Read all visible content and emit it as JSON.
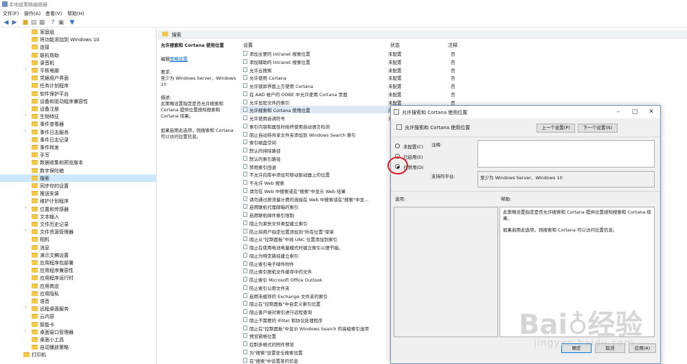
{
  "window": {
    "title": "本地组策略编辑器"
  },
  "menu": [
    "文件(F)",
    "操作(A)",
    "查看(V)",
    "帮助(H)"
  ],
  "tree": [
    {
      "label": "家庭组",
      "arrow": false
    },
    {
      "label": "将功能添加到 Windows 10",
      "arrow": false
    },
    {
      "label": "连接",
      "arrow": false
    },
    {
      "label": "联机帮助",
      "arrow": false
    },
    {
      "label": "录音机",
      "arrow": false
    },
    {
      "label": "平板电脑",
      "arrow": true
    },
    {
      "label": "凭据用户界面",
      "arrow": false
    },
    {
      "label": "任务计划程序",
      "arrow": false
    },
    {
      "label": "软件保护平台",
      "arrow": false
    },
    {
      "label": "设备和驱动程序兼容性",
      "arrow": false
    },
    {
      "label": "设备注册",
      "arrow": false
    },
    {
      "label": "生物特征",
      "arrow": true
    },
    {
      "label": "事件查看器",
      "arrow": false
    },
    {
      "label": "事件日志服务",
      "arrow": true
    },
    {
      "label": "事件日志记录",
      "arrow": false
    },
    {
      "label": "事件转发",
      "arrow": false
    },
    {
      "label": "手写",
      "arrow": false
    },
    {
      "label": "数据收集和预览版本",
      "arrow": false
    },
    {
      "label": "数字保险箱",
      "arrow": false
    },
    {
      "label": "搜索",
      "arrow": false,
      "selected": true
    },
    {
      "label": "同步你的设置",
      "arrow": false
    },
    {
      "label": "推送安装",
      "arrow": false
    },
    {
      "label": "维护计划程序",
      "arrow": false
    },
    {
      "label": "位置和传感器",
      "arrow": true
    },
    {
      "label": "文本输入",
      "arrow": false
    },
    {
      "label": "文件历史记录",
      "arrow": false
    },
    {
      "label": "文件资源管理器",
      "arrow": true
    },
    {
      "label": "相机",
      "arrow": false
    },
    {
      "label": "消息",
      "arrow": false
    },
    {
      "label": "演示文稿设置",
      "arrow": false
    },
    {
      "label": "应用程序包部署",
      "arrow": false
    },
    {
      "label": "应用程序兼容性",
      "arrow": false
    },
    {
      "label": "应用程序运行时",
      "arrow": false
    },
    {
      "label": "应用商店",
      "arrow": false
    },
    {
      "label": "应用隐私",
      "arrow": false
    },
    {
      "label": "语音",
      "arrow": false
    },
    {
      "label": "远程桌面服务",
      "arrow": true
    },
    {
      "label": "云内容",
      "arrow": false
    },
    {
      "label": "智能卡",
      "arrow": false
    },
    {
      "label": "桌面窗口管理器",
      "arrow": true
    },
    {
      "label": "桌面小工具",
      "arrow": false
    },
    {
      "label": "自动播放策略",
      "arrow": false
    },
    {
      "label": "打印机",
      "arrow": false,
      "root": true
    }
  ],
  "middle": {
    "header": "搜索",
    "policy_title": "允许搜索和 Cortana 使用位置",
    "edit_prefix": "编辑",
    "edit_link": "策略设置",
    "req_label": "要求:",
    "req_text": "至少为 Windows Server、Windows 10",
    "desc_label": "描述:",
    "desc_text": "此策略设置指定是否允许搜索和 Cortana 提供位置感知搜索和 Cortana 结果。",
    "desc_text2": "如果启用此选项，则搜索和 Cortana 可以访问位置信息。",
    "col_setting": "设置",
    "col_state": "状态",
    "col_comment": "注释"
  },
  "rows": [
    "添加主要的 Intranet 搜索位置",
    "添加辅助的 Intranet 搜索位置",
    "允许云搜索",
    "允许使用 Cortana",
    "允许锁屏界面上方使用 Cortana",
    "在 AAD 帐户的 OOBE 中允许使用 Cortana 页面",
    "允许加密文件的索引",
    "允许搜索和 Cortana 使用位置",
    "允许使用音调符号",
    "索引内容和属性时始终使用自动语言检测",
    "阻止自动将共享文件夹添加到 Windows Search 索引",
    "索引磁盘空间",
    "默认的排除路径",
    "默认的索引路径",
    "禁用索引回退",
    "不允许向库中添加可移动驱动器上的位置",
    "不允许 Web 搜索",
    "请勿在 Web 中搜索或在\"搜索\"中显示 Web 结果",
    "请勿通过按流量计费的连接在 Web 中搜索或在\"搜索\"中显...",
    "启用联机代理邮箱的索引",
    "启用联机邮件索引限制",
    "阻止为某些文件类型建立索引",
    "防止将用户指定位置添加到\"所有位置\"菜单",
    "阻止从\"控制面板\"中将 UNC 位置添加到索引",
    "阻止在使用电池电量模式时建立索引以便节能。",
    "阻止为特定路径建立索引",
    "防止索引电子邮件附件",
    "防止索引脱机文件缓存中的文件",
    "防止索引 Microsoft Office Outlook",
    "防止索引公用文件夹",
    "启用未缓存的 Exchange 文件夹的索引",
    "阻止在\"控制面板\"中自定义索引位置",
    "阻止客户端对索引进行远程查询",
    "阻止不需要的 iFilter 和协议处理程序",
    "阻止在\"控制面板\"中显示 Windows Search 的高级索引选项",
    "预览窗格位置",
    "控制多格式的附件预览",
    "为\"搜索\"设置安全搜索设置",
    "在\"搜索\"中设置某的信息"
  ],
  "states": [
    {
      "state": "未配置",
      "comment": "否"
    },
    {
      "state": "未配置",
      "comment": "否"
    },
    {
      "state": "未配置",
      "comment": "否"
    },
    {
      "state": "未配置",
      "comment": "否"
    },
    {
      "state": "未配置",
      "comment": "否"
    },
    {
      "state": "未配置",
      "comment": "否"
    },
    {
      "state": "未配置",
      "comment": "否"
    },
    {
      "state": "未配置",
      "comment": "否"
    },
    {
      "state": "未配置",
      "comment": "否"
    }
  ],
  "dialog": {
    "title": "允许搜索和 Cortana 使用位置",
    "subtitle": "允许搜索和 Cortana 使用位置",
    "prev_btn": "上一个设置(P)",
    "next_btn": "下一个设置(N)",
    "radio_notconfig": "未配置(C)",
    "radio_enabled": "已启用(E)",
    "radio_disabled": "已禁用(D)",
    "selected_radio": "disabled",
    "comment_label": "注释:",
    "supported_label": "支持的平台:",
    "supported_text": "至少为 Windows Server、Windows 10",
    "options_label": "选项:",
    "help_label": "帮助:",
    "help_text1": "此策略设置指定是否允许搜索和 Cortana 提供位置感知搜索和 Cortana 结果。",
    "help_text2": "如果启用此选项，则搜索和 Cortana 可以访问位置信息。",
    "ok": "确定",
    "cancel": "取消",
    "apply": "应用(A)"
  },
  "watermark": {
    "brand": "Bai♁经验",
    "url": "jingyan.baidu.com"
  }
}
